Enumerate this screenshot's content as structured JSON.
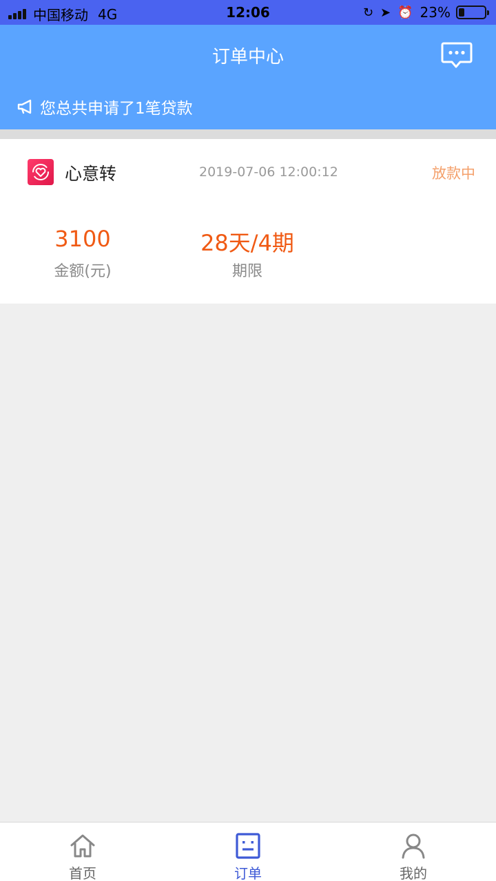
{
  "status_bar": {
    "carrier": "中国移动",
    "network": "4G",
    "time": "12:06",
    "battery": "23%",
    "battery_level": 0.23
  },
  "header": {
    "title": "订单中心",
    "notice": "您总共申请了1笔贷款"
  },
  "order": {
    "product_name": "心意转",
    "date": "2019-07-06 12:00:12",
    "status": "放款中",
    "amount": "3100",
    "amount_label": "金额(元)",
    "term": "28天/4期",
    "term_label": "期限"
  },
  "tabs": [
    {
      "label": "首页",
      "icon": "home-icon",
      "active": false
    },
    {
      "label": "订单",
      "icon": "order-icon",
      "active": true
    },
    {
      "label": "我的",
      "icon": "user-icon",
      "active": false
    }
  ],
  "colors": {
    "status_bar": "#4a63f0",
    "header": "#5aa4ff",
    "accent_orange": "#f05a14",
    "status_orange": "#f4a06b",
    "tab_active": "#3e5ad6"
  }
}
